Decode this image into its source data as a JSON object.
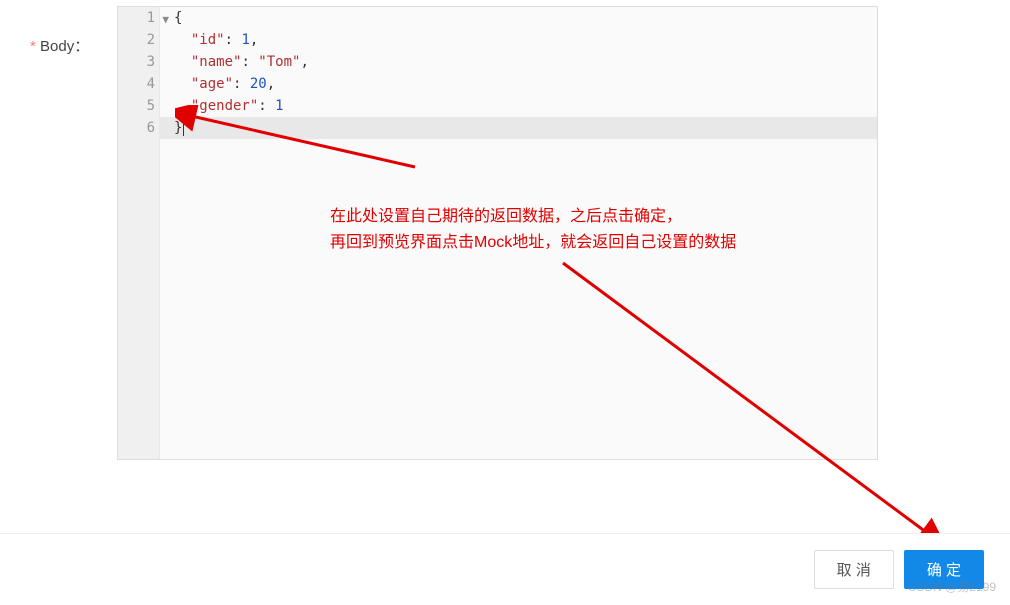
{
  "field": {
    "label": "Body："
  },
  "code": {
    "lines": [
      {
        "num": "1",
        "fold": "▼",
        "tokens": [
          {
            "t": "brace",
            "v": "{"
          }
        ]
      },
      {
        "num": "2",
        "tokens": [
          {
            "t": "indent",
            "v": "  "
          },
          {
            "t": "str",
            "v": "\"id\""
          },
          {
            "t": "punc",
            "v": ": "
          },
          {
            "t": "num",
            "v": "1"
          },
          {
            "t": "punc",
            "v": ","
          }
        ]
      },
      {
        "num": "3",
        "tokens": [
          {
            "t": "indent",
            "v": "  "
          },
          {
            "t": "str",
            "v": "\"name\""
          },
          {
            "t": "punc",
            "v": ": "
          },
          {
            "t": "str",
            "v": "\"Tom\""
          },
          {
            "t": "punc",
            "v": ","
          }
        ]
      },
      {
        "num": "4",
        "tokens": [
          {
            "t": "indent",
            "v": "  "
          },
          {
            "t": "str",
            "v": "\"age\""
          },
          {
            "t": "punc",
            "v": ": "
          },
          {
            "t": "num",
            "v": "20"
          },
          {
            "t": "punc",
            "v": ","
          }
        ]
      },
      {
        "num": "5",
        "tokens": [
          {
            "t": "indent",
            "v": "  "
          },
          {
            "t": "str",
            "v": "\"gender\""
          },
          {
            "t": "punc",
            "v": ": "
          },
          {
            "t": "num",
            "v": "1"
          }
        ]
      },
      {
        "num": "6",
        "active": true,
        "tokens": [
          {
            "t": "brace",
            "v": "}"
          },
          {
            "t": "cursor",
            "v": ""
          }
        ]
      }
    ]
  },
  "annotation": {
    "line1": "在此处设置自己期待的返回数据，之后点击确定，",
    "line2": "再回到预览界面点击Mock地址，就会返回自己设置的数据"
  },
  "footer": {
    "cancel_label": "取 消",
    "confirm_label": "确 定"
  },
  "watermark": "CSDN @易2199"
}
